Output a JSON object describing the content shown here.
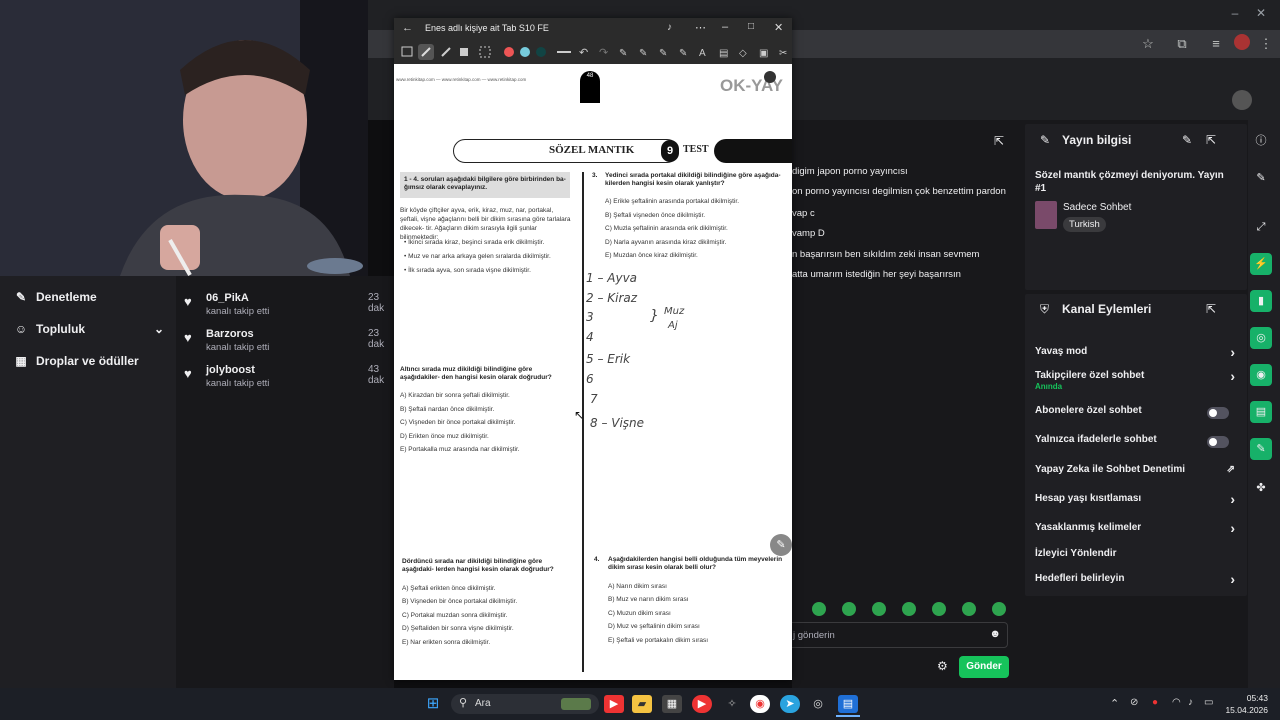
{
  "window": {
    "doc_title": "Enes adlı kişiye ait Tab S10 FE"
  },
  "left_nav": {
    "items": [
      {
        "label": "Denetleme",
        "icon": "wrench-icon"
      },
      {
        "label": "Topluluk",
        "icon": "people-icon"
      },
      {
        "label": "Droplar ve ödüller",
        "icon": "gift-icon"
      }
    ]
  },
  "followers": [
    {
      "name": "06_PikA",
      "sub": "kanalı takip etti",
      "date": "23 dak"
    },
    {
      "name": "Barzoros",
      "sub": "kanalı takip etti",
      "date": "23 dak"
    },
    {
      "name": "jolyboost",
      "sub": "kanalı takip etti",
      "date": "43 dak"
    }
  ],
  "chat": {
    "lines": [
      "digim japon porno yayıncısı",
      "on porno yayıncısı degilmisn çok benzettim pardon",
      "vap c",
      "vamp D",
      "n başarırsın ben sıkıldım zeki insan sevmem",
      "atta umarım istediğin her şeyi başarırsın"
    ],
    "input_placeholder": "j gönderin",
    "send_label": "Gönder"
  },
  "stream_info": {
    "heading": "Yayın bilgisi",
    "title": "Sözel mantık çözmeyi deniyorum. Yayın #1",
    "category": "Sadece Sohbet",
    "tag": "Turkish"
  },
  "channel_actions": {
    "heading": "Kanal Eylemleri",
    "items": [
      {
        "label": "Yavaş mod",
        "control": "arrow"
      },
      {
        "label": "Takipçilere özel sohbet",
        "sub": "Anında",
        "control": "arrow"
      },
      {
        "label": "Abonelere özel sohbet",
        "control": "toggle"
      },
      {
        "label": "Yalnızca ifadelerle sohbet",
        "control": "toggle"
      },
      {
        "label": "Yapay Zeka ile Sohbet Denetimi",
        "control": "external"
      },
      {
        "label": "Hesap yaşı kısıtlaması",
        "control": "arrow"
      },
      {
        "label": "Yasaklanmış kelimeler",
        "control": "arrow"
      },
      {
        "label": "İzleyici Yönlendir",
        "control": "none"
      },
      {
        "label": "Hedefleri belirleyin",
        "control": "arrow"
      }
    ]
  },
  "worksheet": {
    "publisher_urls": "www.retinkitap.com — www.retinkitap.com — www.retinkitap.com",
    "page_number": "48",
    "brand": "OK-YAY",
    "section_title": "SÖZEL MANTIK",
    "test_number": "9",
    "test_label": "TEST",
    "intro_box": "1 - 4. soruları aşağıdaki bilgilere göre birbirinden ba- ğımsız olarak cevaplayınız.",
    "intro_text": "Bir köyde çiftçiler ayva, erik, kiraz, muz, nar, portakal, şeftali, vişne ağaçlarını belli bir dikim sırasına göre tarlalara dikecek- tir. Ağaçların dikim sırasıyla ilgili şunlar bilinmektedir:",
    "rules": [
      "İkinci sırada kiraz, beşinci sırada erik dikilmiştir.",
      "Muz ve nar arka arkaya gelen sıralarda dikilmiştir.",
      "İlk sırada ayva, son sırada vişne dikilmiştir."
    ],
    "q1_head": "Altıncı sırada muz dikildiği bilindiğine göre aşağıdakiler- den hangisi kesin olarak doğrudur?",
    "q1_options": [
      "A) Kirazdan bir sonra şeftali dikilmiştir.",
      "B) Şeftali nardan önce dikilmiştir.",
      "C) Vişneden bir önce portakal dikilmiştir.",
      "D) Erikten önce muz dikilmiştir.",
      "E) Portakalla muz arasında nar dikilmiştir."
    ],
    "q2_head": "Dördüncü sırada nar dikildiği bilindiğine göre aşağıdaki- lerden hangisi kesin olarak doğrudur?",
    "q2_options": [
      "A) Şeftali erikten önce dikilmiştir.",
      "B) Vişneden bir önce portakal dikilmiştir.",
      "C) Portakal muzdan sonra dikilmiştir.",
      "D) Şeftaliden bir sonra vişne dikilmiştir.",
      "E) Nar erikten sonra dikilmiştir."
    ],
    "q3_num": "3.",
    "q3_head": "Yedinci sırada portakal dikildiği bilindiğine göre aşağıda- kilerden hangisi kesin olarak yanlıştır?",
    "q3_options": [
      "A) Erikle şeftalinin arasında portakal dikilmiştir.",
      "B) Şeftali vişneden önce dikilmiştir.",
      "C) Muzla şeftalinin arasında erik dikilmiştir.",
      "D) Narla ayvanın arasında kiraz dikilmiştir.",
      "E) Muzdan önce kiraz dikilmiştir."
    ],
    "q4_num": "4.",
    "q4_head": "Aşağıdakilerden hangisi belli olduğunda tüm meyvelerin dikim sırası kesin olarak belli olur?",
    "q4_options": [
      "A) Narın dikim sırası",
      "B) Muz ve narın dikim sırası",
      "C) Muzun dikim sırası",
      "D) Muz ve şeftalinin dikim sırası",
      "E) Şeftali ve portakalın dikim sırası"
    ],
    "handwriting": [
      "1 – Ayva",
      "2 – Kiraz",
      "3",
      "4",
      "5 – Erik",
      "6",
      "7",
      "8 – Vişne",
      "Muz",
      "Aj"
    ]
  },
  "taskbar": {
    "search_label": "Ara",
    "time": "05:43",
    "date": "15.04.2026"
  }
}
